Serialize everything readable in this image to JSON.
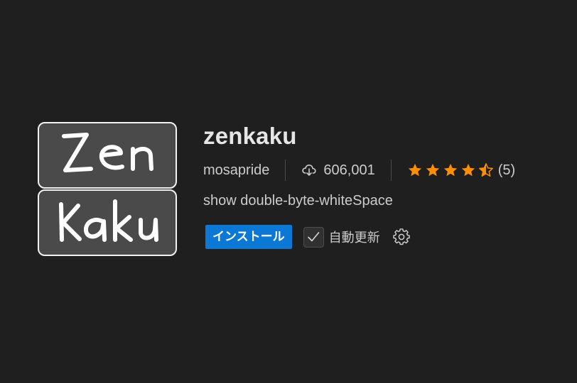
{
  "extension": {
    "logo_text_line1": "Zen",
    "logo_text_line2": "Kaku",
    "name": "zenkaku",
    "publisher": "mosapride",
    "download_count": "606,001",
    "rating": 4.5,
    "rating_count": "(5)",
    "description": "show double-byte-whiteSpace"
  },
  "actions": {
    "install_label": "インストール",
    "auto_update_label": "自動更新",
    "auto_update_checked": true
  },
  "icons": {
    "download": "cloud-download-icon",
    "star": "star-icon",
    "settings": "gear-icon",
    "check": "checkmark-icon"
  },
  "colors": {
    "background": "#1f1f1f",
    "star": "#ff8e00",
    "install_button": "#0a78d4",
    "text": "#cccccc",
    "title": "#e6e6e6"
  }
}
